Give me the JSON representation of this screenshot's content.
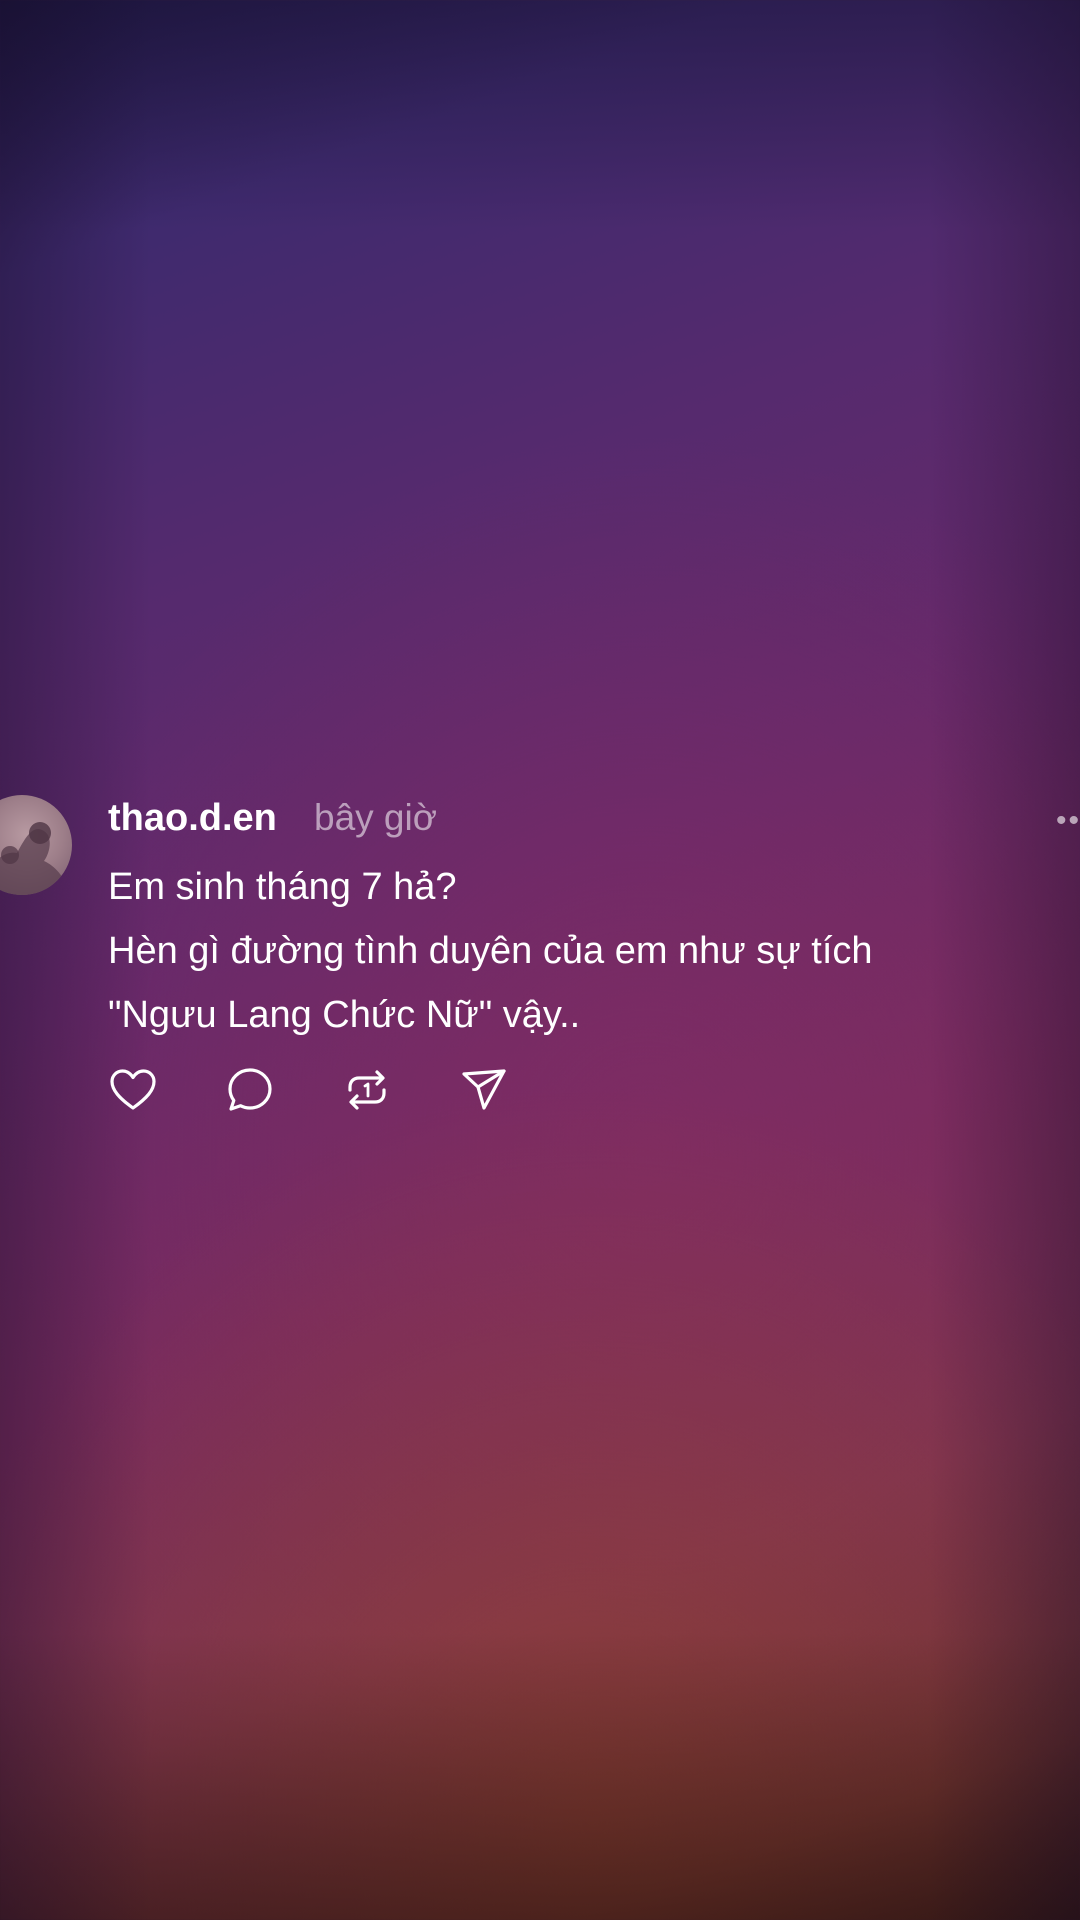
{
  "post": {
    "username": "thao.d.en",
    "time": "bây giờ",
    "more_label": "••",
    "content_lines": [
      "Em sinh tháng 7 hả?",
      "Hèn gì đường tình duyên của em như sự tích",
      "\"Ngưu Lang Chức Nữ\" vậy.."
    ]
  },
  "actions": [
    {
      "icon": "heart-icon"
    },
    {
      "icon": "comment-icon"
    },
    {
      "icon": "repost-icon"
    },
    {
      "icon": "share-icon"
    }
  ],
  "colors": {
    "text": "#ffffff",
    "muted_text": "#a99aae",
    "background_top": "#231a4a",
    "background_mid": "#66296a",
    "background_bottom": "#7d3350"
  }
}
